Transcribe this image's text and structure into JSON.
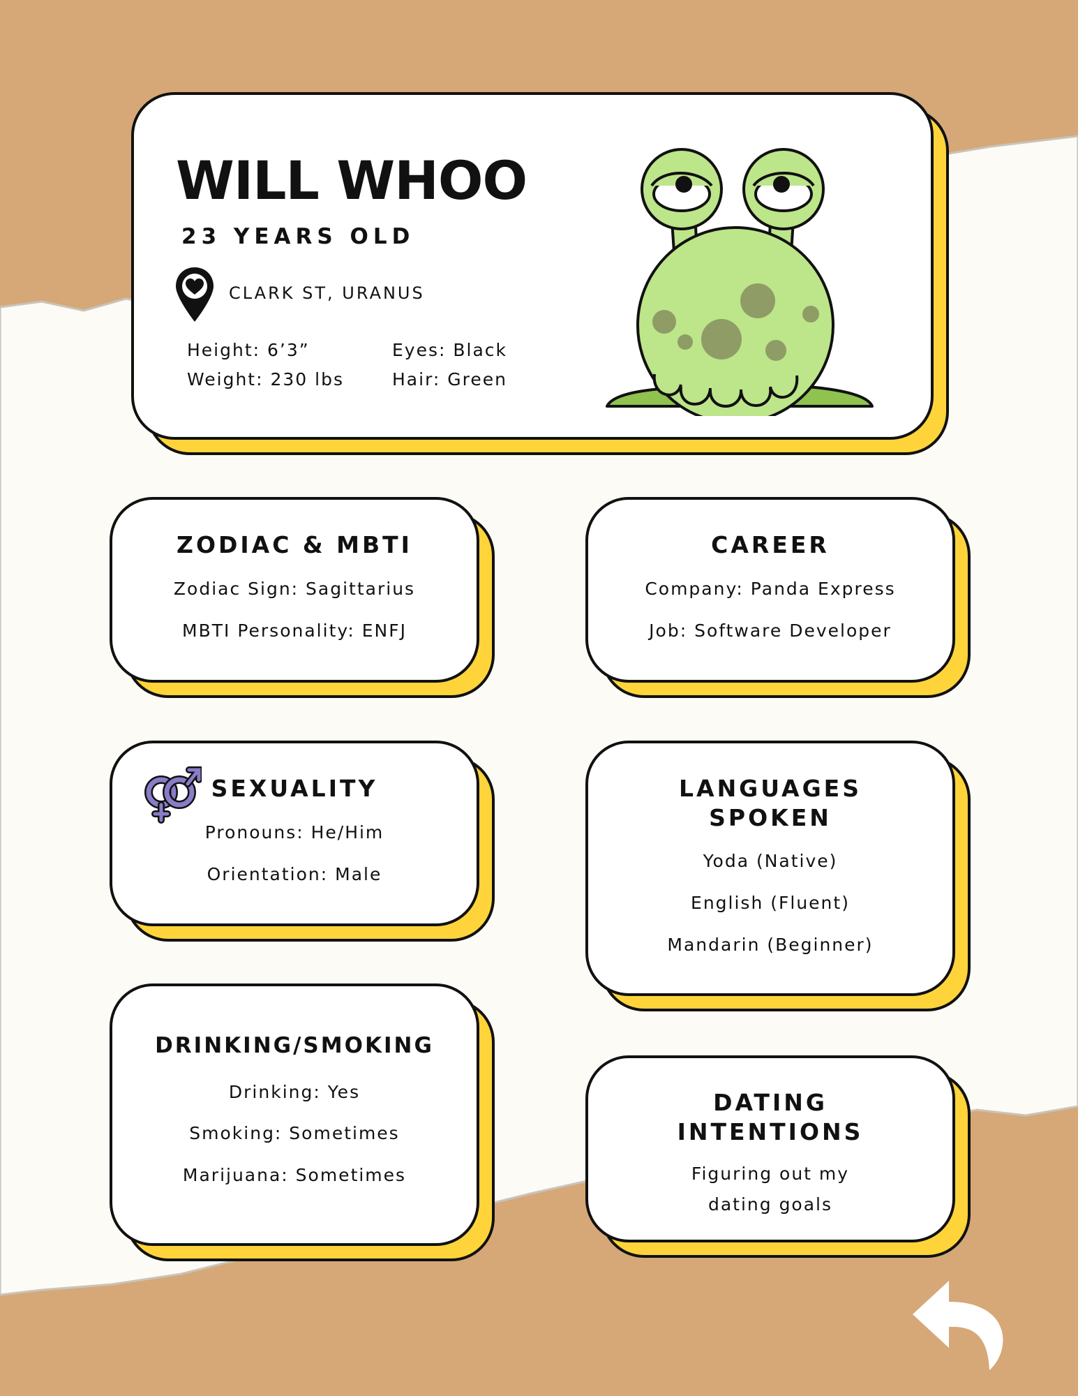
{
  "profile": {
    "name": "WILL WHOO",
    "age": "23 YEARS OLD",
    "location": "CLARK ST, URANUS",
    "height": "Height: 6’3”",
    "weight": "Weight: 230 lbs",
    "eyes": "Eyes: Black",
    "hair": "Hair: Green",
    "icons": {
      "location": "map-pin-heart-icon",
      "avatar": "green-alien-illustration"
    }
  },
  "zodiac_mbti": {
    "title": "ZODIAC & MBTI",
    "lines": [
      "Zodiac Sign: Sagittarius",
      "MBTI Personality: ENFJ"
    ]
  },
  "career": {
    "title": "CAREER",
    "lines": [
      "Company: Panda Express",
      "Job: Software Developer"
    ]
  },
  "sexuality": {
    "title": "SEXUALITY",
    "icon": "gender-symbols-icon",
    "lines": [
      "Pronouns: He/Him",
      "Orientation: Male"
    ]
  },
  "languages": {
    "title_lines": [
      "LANGUAGES",
      "SPOKEN"
    ],
    "lines": [
      "Yoda (Native)",
      "English (Fluent)",
      "Mandarin (Beginner)"
    ]
  },
  "drinking_smoking": {
    "title": "DRINKING/SMOKING",
    "lines": [
      "Drinking: Yes",
      "Smoking: Sometimes",
      "Marijuana: Sometimes"
    ]
  },
  "dating": {
    "title_lines": [
      "DATING",
      "INTENTIONS"
    ],
    "lines": [
      "Figuring out my",
      "dating goals"
    ]
  },
  "navigation": {
    "back_icon": "back-arrow-icon"
  },
  "colors": {
    "kraft": "#d6a877",
    "paper": "#fcfbf6",
    "accent_yellow": "#ffd43b",
    "alien_green": "#bde58a",
    "alien_spots": "#8f9c66",
    "outline": "#111111"
  }
}
